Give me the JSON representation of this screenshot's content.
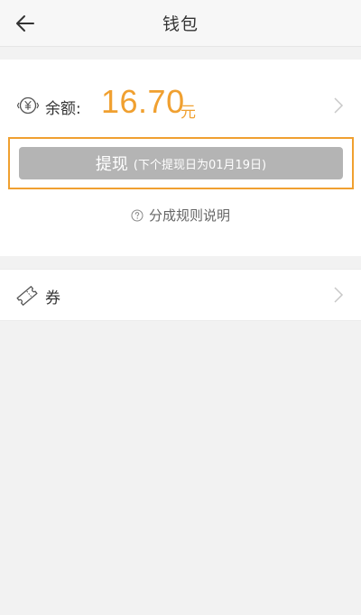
{
  "header": {
    "title": "钱包"
  },
  "balance": {
    "label": "余额:",
    "amount": "16.70",
    "unit": "元"
  },
  "withdraw": {
    "label": "提现",
    "sub_label": "(下个提现日为01月19日)"
  },
  "rules": {
    "label": "分成规则说明"
  },
  "coupon": {
    "label": "券"
  },
  "colors": {
    "accent": "#f0a030",
    "button_disabled": "#b4b4b4",
    "background": "#f2f2f2"
  },
  "icons": {
    "back": "arrow-left-icon",
    "balance": "yen-coin-icon",
    "rules": "question-circle-icon",
    "coupon": "ticket-icon",
    "chevron": "chevron-right-icon"
  }
}
